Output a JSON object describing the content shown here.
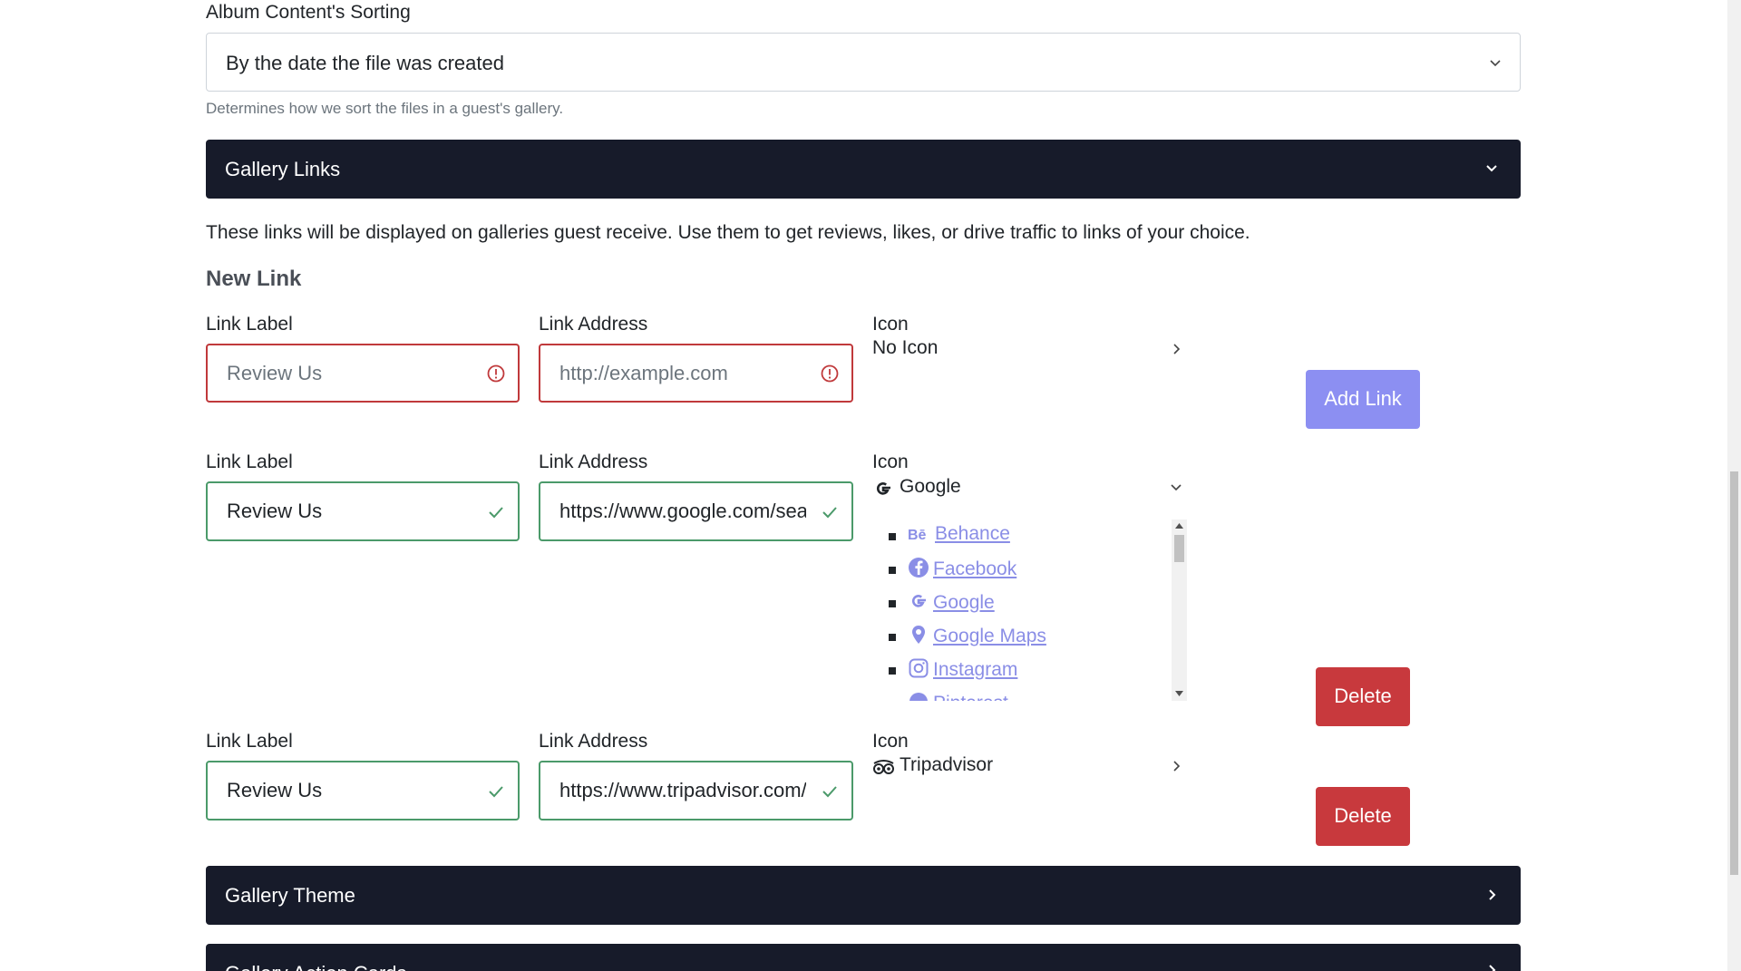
{
  "sorting": {
    "label": "Album Content's Sorting",
    "selected": "By the date the file was created",
    "help": "Determines how we sort the files in a guest's gallery."
  },
  "gallery_links": {
    "title": "Gallery Links",
    "description": "These links will be displayed on galleries guest receive. Use them to get reviews, likes, or drive traffic to links of your choice.",
    "new_link_heading": "New Link",
    "new_link": {
      "label_title": "Link Label",
      "label_placeholder": "Review Us",
      "address_title": "Link Address",
      "address_placeholder": "http://example.com",
      "icon_title": "Icon",
      "icon_value": "No Icon",
      "add_button": "Add Link"
    },
    "links": [
      {
        "label_title": "Link Label",
        "label_value": "Review Us",
        "address_title": "Link Address",
        "address_value": "https://www.google.com/search",
        "icon_title": "Icon",
        "icon_value": "Google",
        "delete_button": "Delete",
        "icon_options": [
          "Behance",
          "Facebook",
          "Google",
          "Google Maps",
          "Instagram",
          "Pinterest"
        ]
      },
      {
        "label_title": "Link Label",
        "label_value": "Review Us",
        "address_title": "Link Address",
        "address_value": "https://www.tripadvisor.com/",
        "icon_title": "Icon",
        "icon_value": "Tripadvisor",
        "delete_button": "Delete"
      }
    ]
  },
  "sections": {
    "gallery_theme": "Gallery Theme",
    "gallery_action_cards": "Gallery Action Cards"
  },
  "colors": {
    "dark_bar": "#171b2a",
    "add_button": "#8c8ff2",
    "delete_button": "#c8393d",
    "invalid": "#c0393b",
    "valid": "#4b9a6a",
    "link": "#8a8ee6"
  }
}
